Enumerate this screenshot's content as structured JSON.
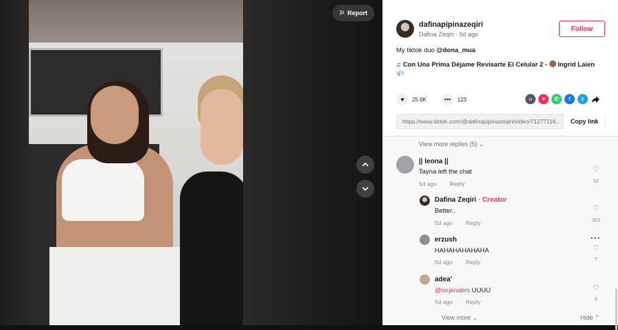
{
  "video": {
    "report_label": "Report"
  },
  "author": {
    "username": "dafinapipinazeqiri",
    "display_name": "Dafina Zeqiri",
    "age": "6d ago",
    "follow_label": "Follow"
  },
  "post": {
    "caption_prefix": "My tiktok duo ",
    "caption_mention": "@dona_mua",
    "music_note": "♫",
    "music_title": "Con Una Prima Déjame Revisarte El Celular 2 - ",
    "music_artist": "Ingrid Laien",
    "likes": "25.6K",
    "comments": "123",
    "link": "https://www.tiktok.com/@dafinapipinazeqiri/video/71277116...",
    "copy_label": "Copy link"
  },
  "share_icons": [
    {
      "name": "embed-icon",
      "glyph": "‹›",
      "color": "#55575f"
    },
    {
      "name": "friends-share-icon",
      "glyph": "▼",
      "color": "#fe2c55"
    },
    {
      "name": "whatsapp-icon",
      "glyph": "✆",
      "color": "#25d366"
    },
    {
      "name": "facebook-icon",
      "glyph": "f",
      "color": "#1877f2"
    },
    {
      "name": "twitter-icon",
      "glyph": "t",
      "color": "#1da1f2"
    }
  ],
  "comments": {
    "view_more_replies": "View more replies (5)",
    "reply_label": "Reply",
    "items": [
      {
        "name": "|| leona ||",
        "text": "Tayna left the chat",
        "age": "5d ago",
        "likes": "52"
      },
      {
        "name": "Dafina Zeqiri",
        "badge": "Creator",
        "badge_sep": " · ",
        "text": "Better..",
        "age": "5d ago",
        "likes": "302"
      },
      {
        "name": "erzush",
        "text": "HAHAHAHAHAHA",
        "age": "5d ago",
        "likes": "7"
      },
      {
        "name": "adea'",
        "mention": "@lorjanabrs",
        "text": " UUUU",
        "age": "5d ago",
        "likes": "3"
      }
    ],
    "view_more": "View more",
    "hide": "Hide"
  },
  "colors": {
    "accent": "#fe2c55",
    "text": "#161823",
    "muted": "#8a8b91"
  }
}
